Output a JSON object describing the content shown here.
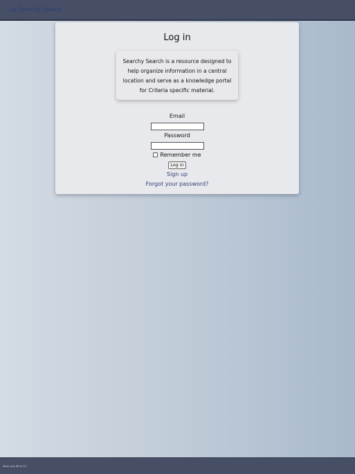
{
  "navbar": {
    "brand": "Le Searchy Search"
  },
  "login": {
    "title": "Log in",
    "intro": "Searchy Search is a resource designed to help organize information in a central location and serve as a knowledge portal for Criteria specific material.",
    "email_label": "Email",
    "email_value": "",
    "password_label": "Password",
    "password_value": "",
    "remember_label": "Remember me",
    "remember_checked": false,
    "submit_label": "Log in",
    "signup_link": "Sign up",
    "forgot_link": "Forgot your password?"
  },
  "footer": {
    "text": "Made with ♥ for SS"
  }
}
